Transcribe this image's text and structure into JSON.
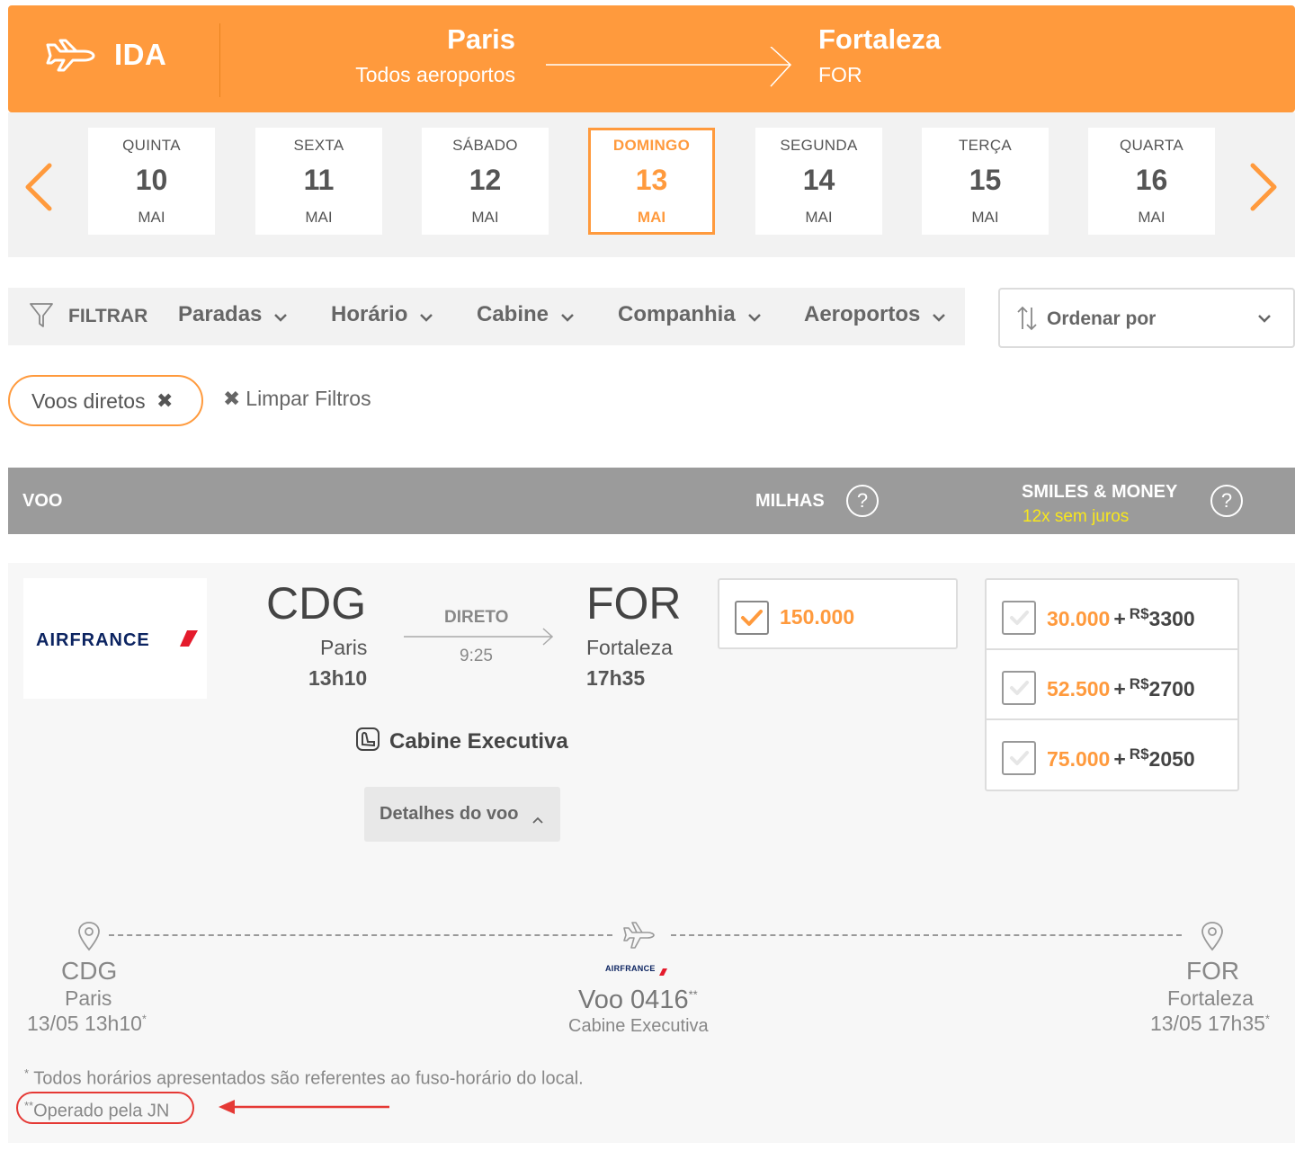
{
  "header": {
    "direction_label": "IDA",
    "origin_city": "Paris",
    "origin_sub": "Todos aeroportos",
    "dest_city": "Fortaleza",
    "dest_sub": "FOR",
    "accent_color": "#ff9a3d"
  },
  "dates": [
    {
      "dow": "QUINTA",
      "day": "10",
      "mon": "MAI"
    },
    {
      "dow": "SEXTA",
      "day": "11",
      "mon": "MAI"
    },
    {
      "dow": "SÁBADO",
      "day": "12",
      "mon": "MAI"
    },
    {
      "dow": "DOMINGO",
      "day": "13",
      "mon": "MAI",
      "selected": true
    },
    {
      "dow": "SEGUNDA",
      "day": "14",
      "mon": "MAI"
    },
    {
      "dow": "TERÇA",
      "day": "15",
      "mon": "MAI"
    },
    {
      "dow": "QUARTA",
      "day": "16",
      "mon": "MAI"
    }
  ],
  "filters": {
    "label": "FILTRAR",
    "dropdowns": [
      "Paradas",
      "Horário",
      "Cabine",
      "Companhia",
      "Aeroportos"
    ],
    "sort_label": "Ordenar por",
    "active_chip": "Voos diretos",
    "clear_label": "Limpar Filtros"
  },
  "results_header": {
    "col_flight": "VOO",
    "col_miles": "MILHAS",
    "col_smiles_money": "SMILES & MONEY",
    "col_smiles_money_sub": "12x sem juros",
    "help": "?"
  },
  "flight": {
    "airline": "AIRFRANCE",
    "origin_code": "CDG",
    "origin_city": "Paris",
    "origin_time": "13h10",
    "stop_label": "DIRETO",
    "duration": "9:25",
    "dest_code": "FOR",
    "dest_city": "Fortaleza",
    "dest_time": "17h35",
    "cabin": "Cabine Executiva",
    "details_label": "Detalhes do voo",
    "miles_price": "150.000",
    "smiles_money": [
      {
        "miles": "30.000",
        "plus": "+",
        "currency": "R$",
        "money": "3300"
      },
      {
        "miles": "52.500",
        "plus": "+",
        "currency": "R$",
        "money": "2700"
      },
      {
        "miles": "75.000",
        "plus": "+",
        "currency": "R$",
        "money": "2050"
      }
    ]
  },
  "timeline": {
    "origin_code": "CDG",
    "origin_city": "Paris",
    "origin_dt": "13/05 13h10",
    "dest_code": "FOR",
    "dest_city": "Fortaleza",
    "dest_dt": "13/05 17h35",
    "airline": "AIRFRANCE",
    "flight_no": "Voo 0416",
    "cabin": "Cabine Executiva",
    "mark_single": "*",
    "mark_double": "**"
  },
  "footnotes": {
    "timezone_note": "Todos horários apresentados são referentes ao fuso-horário do local.",
    "operated_note": "Operado pela JN"
  }
}
